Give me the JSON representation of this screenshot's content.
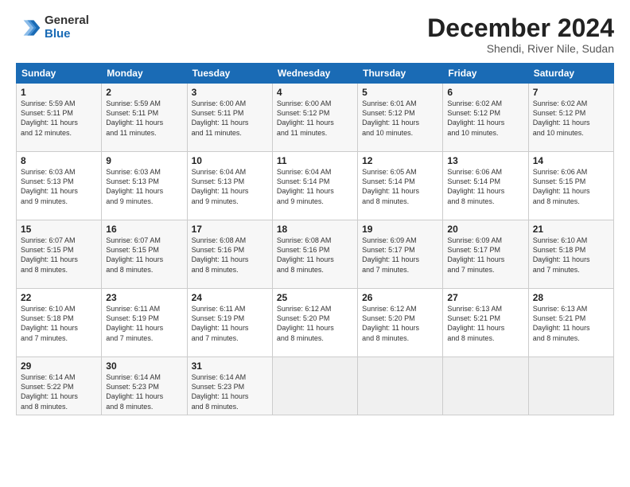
{
  "logo": {
    "general": "General",
    "blue": "Blue"
  },
  "header": {
    "month": "December 2024",
    "location": "Shendi, River Nile, Sudan"
  },
  "days_of_week": [
    "Sunday",
    "Monday",
    "Tuesday",
    "Wednesday",
    "Thursday",
    "Friday",
    "Saturday"
  ],
  "weeks": [
    [
      {
        "day": 1,
        "sunrise": "5:59 AM",
        "sunset": "5:11 PM",
        "daylight": "11 hours and 12 minutes."
      },
      {
        "day": 2,
        "sunrise": "5:59 AM",
        "sunset": "5:11 PM",
        "daylight": "11 hours and 11 minutes."
      },
      {
        "day": 3,
        "sunrise": "6:00 AM",
        "sunset": "5:11 PM",
        "daylight": "11 hours and 11 minutes."
      },
      {
        "day": 4,
        "sunrise": "6:00 AM",
        "sunset": "5:12 PM",
        "daylight": "11 hours and 11 minutes."
      },
      {
        "day": 5,
        "sunrise": "6:01 AM",
        "sunset": "5:12 PM",
        "daylight": "11 hours and 10 minutes."
      },
      {
        "day": 6,
        "sunrise": "6:02 AM",
        "sunset": "5:12 PM",
        "daylight": "11 hours and 10 minutes."
      },
      {
        "day": 7,
        "sunrise": "6:02 AM",
        "sunset": "5:12 PM",
        "daylight": "11 hours and 10 minutes."
      }
    ],
    [
      {
        "day": 8,
        "sunrise": "6:03 AM",
        "sunset": "5:13 PM",
        "daylight": "11 hours and 9 minutes."
      },
      {
        "day": 9,
        "sunrise": "6:03 AM",
        "sunset": "5:13 PM",
        "daylight": "11 hours and 9 minutes."
      },
      {
        "day": 10,
        "sunrise": "6:04 AM",
        "sunset": "5:13 PM",
        "daylight": "11 hours and 9 minutes."
      },
      {
        "day": 11,
        "sunrise": "6:04 AM",
        "sunset": "5:14 PM",
        "daylight": "11 hours and 9 minutes."
      },
      {
        "day": 12,
        "sunrise": "6:05 AM",
        "sunset": "5:14 PM",
        "daylight": "11 hours and 8 minutes."
      },
      {
        "day": 13,
        "sunrise": "6:06 AM",
        "sunset": "5:14 PM",
        "daylight": "11 hours and 8 minutes."
      },
      {
        "day": 14,
        "sunrise": "6:06 AM",
        "sunset": "5:15 PM",
        "daylight": "11 hours and 8 minutes."
      }
    ],
    [
      {
        "day": 15,
        "sunrise": "6:07 AM",
        "sunset": "5:15 PM",
        "daylight": "11 hours and 8 minutes."
      },
      {
        "day": 16,
        "sunrise": "6:07 AM",
        "sunset": "5:15 PM",
        "daylight": "11 hours and 8 minutes."
      },
      {
        "day": 17,
        "sunrise": "6:08 AM",
        "sunset": "5:16 PM",
        "daylight": "11 hours and 8 minutes."
      },
      {
        "day": 18,
        "sunrise": "6:08 AM",
        "sunset": "5:16 PM",
        "daylight": "11 hours and 8 minutes."
      },
      {
        "day": 19,
        "sunrise": "6:09 AM",
        "sunset": "5:17 PM",
        "daylight": "11 hours and 7 minutes."
      },
      {
        "day": 20,
        "sunrise": "6:09 AM",
        "sunset": "5:17 PM",
        "daylight": "11 hours and 7 minutes."
      },
      {
        "day": 21,
        "sunrise": "6:10 AM",
        "sunset": "5:18 PM",
        "daylight": "11 hours and 7 minutes."
      }
    ],
    [
      {
        "day": 22,
        "sunrise": "6:10 AM",
        "sunset": "5:18 PM",
        "daylight": "11 hours and 7 minutes."
      },
      {
        "day": 23,
        "sunrise": "6:11 AM",
        "sunset": "5:19 PM",
        "daylight": "11 hours and 7 minutes."
      },
      {
        "day": 24,
        "sunrise": "6:11 AM",
        "sunset": "5:19 PM",
        "daylight": "11 hours and 7 minutes."
      },
      {
        "day": 25,
        "sunrise": "6:12 AM",
        "sunset": "5:20 PM",
        "daylight": "11 hours and 8 minutes."
      },
      {
        "day": 26,
        "sunrise": "6:12 AM",
        "sunset": "5:20 PM",
        "daylight": "11 hours and 8 minutes."
      },
      {
        "day": 27,
        "sunrise": "6:13 AM",
        "sunset": "5:21 PM",
        "daylight": "11 hours and 8 minutes."
      },
      {
        "day": 28,
        "sunrise": "6:13 AM",
        "sunset": "5:21 PM",
        "daylight": "11 hours and 8 minutes."
      }
    ],
    [
      {
        "day": 29,
        "sunrise": "6:14 AM",
        "sunset": "5:22 PM",
        "daylight": "11 hours and 8 minutes."
      },
      {
        "day": 30,
        "sunrise": "6:14 AM",
        "sunset": "5:23 PM",
        "daylight": "11 hours and 8 minutes."
      },
      {
        "day": 31,
        "sunrise": "6:14 AM",
        "sunset": "5:23 PM",
        "daylight": "11 hours and 8 minutes."
      },
      null,
      null,
      null,
      null
    ]
  ]
}
